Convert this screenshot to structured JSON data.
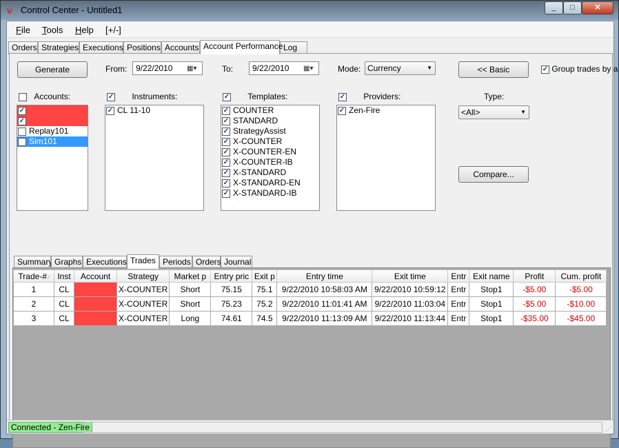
{
  "window": {
    "title": "Control Center - Untitled1",
    "min": "_",
    "max": "□",
    "close": "✕"
  },
  "menu": [
    {
      "label": "File",
      "key": "F",
      "rest": "ile"
    },
    {
      "label": "Tools",
      "key": "T",
      "rest": "ools"
    },
    {
      "label": "Help",
      "key": "H",
      "rest": "elp"
    },
    {
      "label": "[+/-]"
    }
  ],
  "main_tabs": [
    "Orders",
    "Strategies",
    "Executions",
    "Positions",
    "Accounts",
    "Account Performance",
    "Log"
  ],
  "main_tab_active": "Account Performance",
  "controls": {
    "generate": "Generate",
    "from_label": "From:",
    "from_value": "9/22/2010",
    "to_label": "To:",
    "to_value": "9/22/2010",
    "mode_label": "Mode:",
    "mode_value": "Currency",
    "basic": "<< Basic",
    "group_trades": "Group trades by a",
    "type_label": "Type:",
    "type_value": "<All>",
    "compare": "Compare..."
  },
  "lists": {
    "accounts": {
      "label": "Accounts:",
      "items": [
        "",
        "",
        "Replay101",
        "Sim101"
      ]
    },
    "instruments": {
      "label": "Instruments:",
      "items": [
        "CL 11-10"
      ]
    },
    "templates": {
      "label": "Templates:",
      "items": [
        "COUNTER",
        "STANDARD",
        "StrategyAssist",
        "X-COUNTER",
        "X-COUNTER-EN",
        "X-COUNTER-IB",
        "X-STANDARD",
        "X-STANDARD-EN",
        "X-STANDARD-IB"
      ]
    },
    "providers": {
      "label": "Providers:",
      "items": [
        "Zen-Fire"
      ]
    }
  },
  "sub_tabs": [
    "Summary",
    "Graphs",
    "Executions",
    "Trades",
    "Periods",
    "Orders",
    "Journal"
  ],
  "sub_tab_active": "Trades",
  "table": {
    "columns": [
      "Trade-#",
      "Inst",
      "Account",
      "Strategy",
      "Market p",
      "Entry pric",
      "Exit p",
      "Entry time",
      "Exit time",
      "Entr",
      "Exit name",
      "Profit",
      "Cum. profit"
    ],
    "rows": [
      [
        "1",
        "CL",
        "",
        "X-COUNTER",
        "Short",
        "75.15",
        "75.1",
        "9/22/2010 10:58:03 AM",
        "9/22/2010 10:59:12",
        "Entr",
        "Stop1",
        "-$5.00",
        "-$5.00"
      ],
      [
        "2",
        "CL",
        "",
        "X-COUNTER",
        "Short",
        "75.23",
        "75.2",
        "9/22/2010 11:01:41 AM",
        "9/22/2010 11:03:04",
        "Entr",
        "Stop1",
        "-$5.00",
        "-$10.00"
      ],
      [
        "3",
        "CL",
        "",
        "X-COUNTER",
        "Long",
        "74.61",
        "74.5",
        "9/22/2010 11:13:09 AM",
        "9/22/2010 11:13:44",
        "Entr",
        "Stop1",
        "-$35.00",
        "-$45.00"
      ]
    ]
  },
  "status": {
    "connection": "Connected - Zen-Fire"
  },
  "colors": {
    "negative": "#e00000",
    "redaction": "#ff4444",
    "selection": "#3399ff",
    "connected": "#90ee90"
  }
}
